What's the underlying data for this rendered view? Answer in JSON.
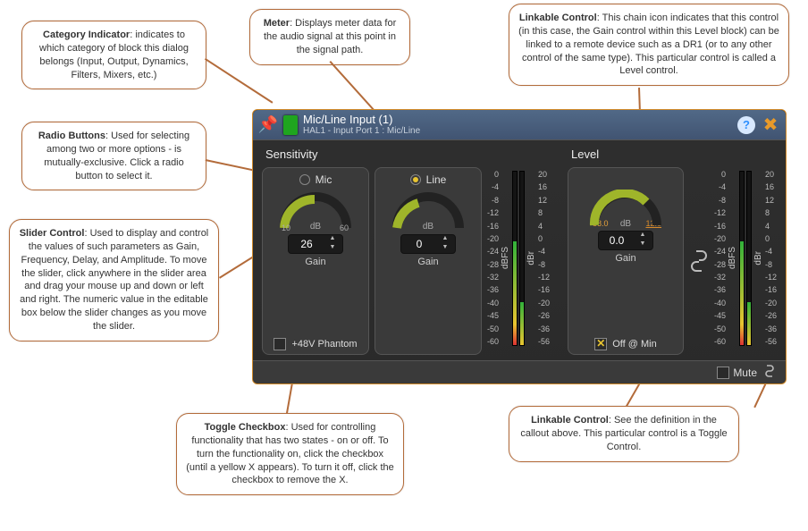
{
  "callouts": {
    "category": {
      "title": "Category Indicator",
      "text": ": indicates to which category of block this dialog belongs (Input, Output, Dynamics, Filters, Mixers, etc.)"
    },
    "radio": {
      "title": "Radio Buttons",
      "text": ": Used for selecting among two or more options - is mutually-exclusive. Click a radio button to select it."
    },
    "slider": {
      "title": "Slider Control",
      "text": ": Used to display and control the values of such parameters as Gain, Frequency, Delay, and Amplitude. To move the slider, click anywhere in the slider area and drag your mouse up and down or left and right. The numeric value in the editable box below the slider changes as you move the slider."
    },
    "meter": {
      "title": "Meter",
      "text": ": Displays meter data for the audio signal at this point in the signal path."
    },
    "linkable1": {
      "title": "Linkable Control",
      "text": ": This chain icon indicates that this control (in this case, the Gain control within this Level block) can be linked to a remote device such as a DR1 (or to any other control of the same type). This particular control is called a Level control."
    },
    "toggle": {
      "title": "Toggle Checkbox",
      "text": ": Used for controlling functionality that has two states - on or off. To turn the functionality on, click the checkbox (until a yellow X appears). To turn it off, click the checkbox to remove the X."
    },
    "linkable2": {
      "title": "Linkable Control",
      "text": ": See the definition in the callout above. This particular control is a Toggle Control."
    }
  },
  "panel": {
    "title": "Mic/Line Input (1)",
    "subtitle": "HAL1 - Input Port 1  :  Mic/Line"
  },
  "sensitivity": {
    "title": "Sensitivity",
    "mic": {
      "label": "Mic",
      "range_low": "10",
      "range_high": "60",
      "db": "dB",
      "value": "26",
      "gain_label": "Gain"
    },
    "line": {
      "label": "Line",
      "db": "dB",
      "value": "0",
      "gain_label": "Gain"
    },
    "phantom": "+48V Phantom"
  },
  "level": {
    "title": "Level",
    "db": "dB",
    "limit_neg": "-88.0",
    "limit_pos": "12.0",
    "value": "0.0",
    "gain_label": "Gain",
    "offmin": "Off @ Min"
  },
  "meter_scale_l": [
    "0",
    "-4",
    "-8",
    "-12",
    "-16",
    "-20",
    "-24",
    "-28",
    "-32",
    "-36",
    "-40",
    "-45",
    "-50",
    "-60"
  ],
  "meter_scale_r": [
    "20",
    "16",
    "12",
    "8",
    "4",
    "0",
    "-4",
    "-8",
    "-12",
    "-16",
    "-20",
    "-26",
    "-36",
    "-56"
  ],
  "meter_axis_l": "dBFS",
  "meter_axis_r": "dBr",
  "footer": {
    "mute": "Mute"
  }
}
